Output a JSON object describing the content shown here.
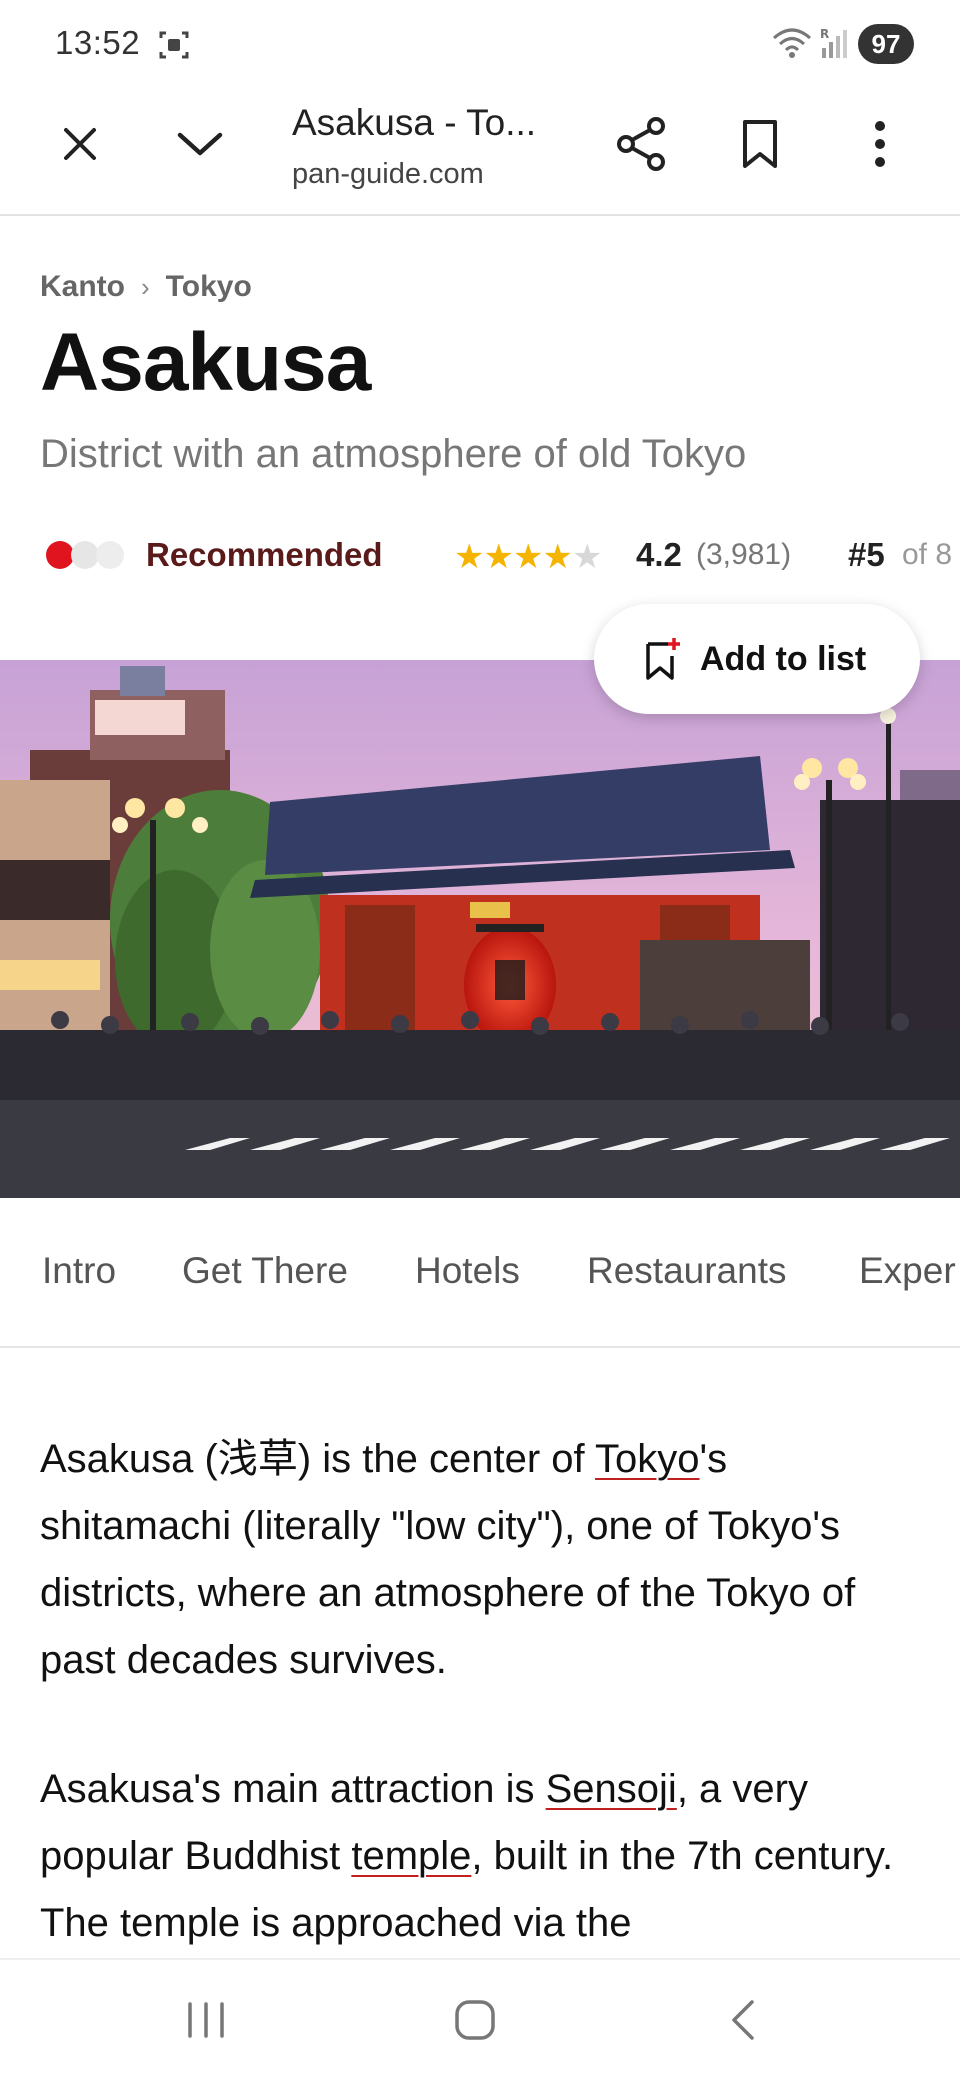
{
  "status_bar": {
    "time": "13:52",
    "battery": "97",
    "icons": [
      "screen-capture-icon",
      "wifi-icon",
      "signal-icon"
    ]
  },
  "browser": {
    "title": "Asakusa - To...",
    "url": "pan-guide.com",
    "icons": [
      "close-icon",
      "chevron-down-icon",
      "share-icon",
      "bookmark-icon",
      "more-vertical-icon"
    ]
  },
  "breadcrumb": {
    "items": [
      "Kanto",
      "Tokyo"
    ],
    "separator": "›"
  },
  "page": {
    "title": "Asakusa",
    "subtitle": "District with an atmosphere of old Tokyo"
  },
  "meta": {
    "recommendation": "Recommended",
    "recommendation_level": 1,
    "recommendation_max": 3,
    "stars": 4,
    "stars_max": 5,
    "rating": "4.2",
    "rating_count": "(3,981)",
    "rank": "#5",
    "rank_of": "of 8"
  },
  "add_to_list": {
    "label": "Add to list"
  },
  "tabs": [
    "Intro",
    "Get There",
    "Hotels",
    "Restaurants",
    "Exper"
  ],
  "article": {
    "p1_a": "Asakusa (浅草) is the center of ",
    "p1_link": "Tokyo",
    "p1_b": "'s shitamachi (literally \"low city\"), one of Tokyo's districts, where an atmosphere of the Tokyo of past decades survives.",
    "p2_a": "Asakusa's main attraction is ",
    "p2_link1": "Sensoji",
    "p2_b": ", a very popular Buddhist ",
    "p2_link2": "temple",
    "p2_c": ", built in the 7th century. The temple is approached via the"
  },
  "colors": {
    "accent_red": "#e0141e",
    "star": "#f5b400",
    "recommended_text": "#5b1a1a",
    "link_underline": "#c21f1f"
  }
}
